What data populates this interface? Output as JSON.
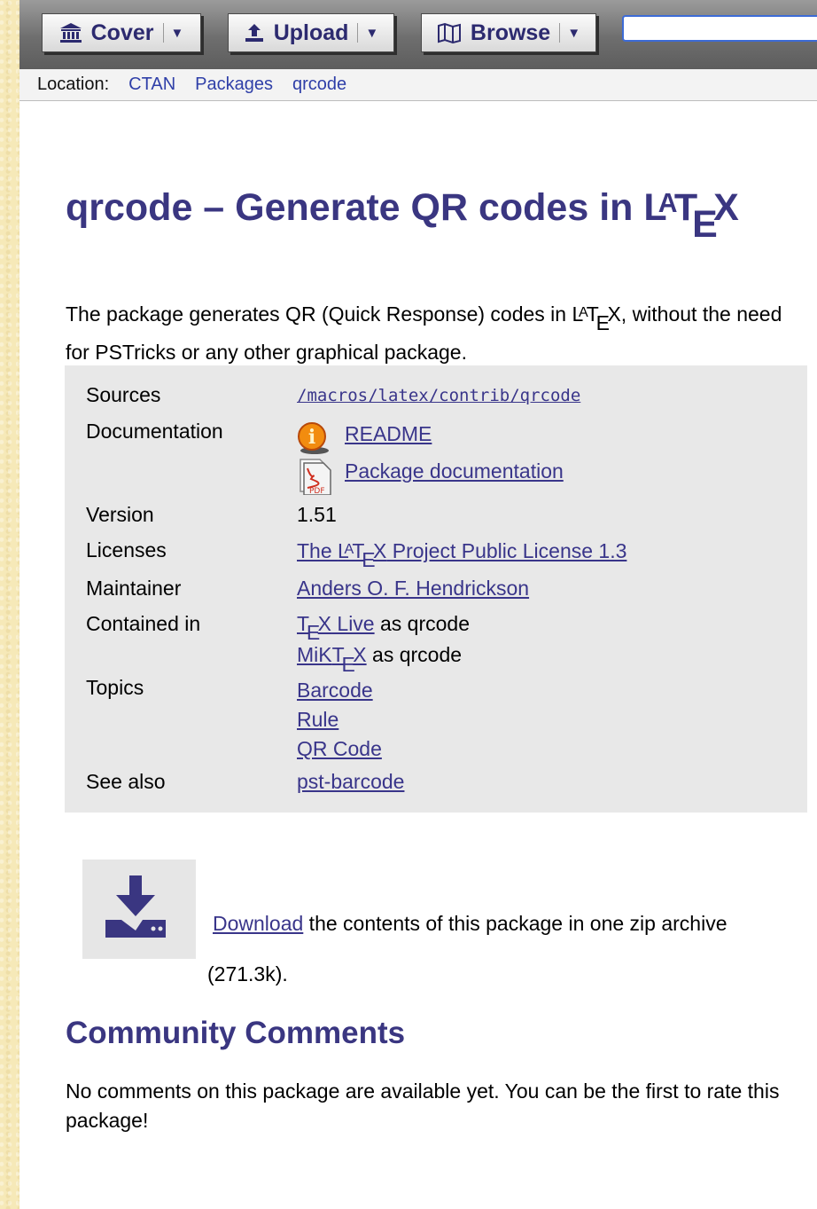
{
  "toolbar": {
    "cover_label": "Cover",
    "upload_label": "Upload",
    "browse_label": "Browse",
    "search_value": ""
  },
  "location": {
    "label": "Location:",
    "crumbs": [
      "CTAN",
      "Packages",
      "qrcode"
    ]
  },
  "title": {
    "prefix": "qrcode – Generate QR codes in ",
    "latex": {
      "L": "L",
      "A": "A",
      "T": "T",
      "E": "E",
      "X": "X"
    }
  },
  "description": {
    "before": "The package generates QR (Quick Response) codes in ",
    "after": ", without the need for PSTricks or any other graphical package."
  },
  "info": {
    "sources_label": "Sources",
    "sources_value": "/macros/latex/contrib/qrcode",
    "documentation_label": "Documentation",
    "docs": [
      "README",
      "Package documentation"
    ],
    "version_label": "Version",
    "version_value": "1.51",
    "licenses_label": "Licenses",
    "license_prefix": "The ",
    "license_suffix": " Project Public License 1.3",
    "maintainer_label": "Maintainer",
    "maintainer_value": "Anders O. F. Hendrickson",
    "contained_label": "Contained in",
    "texlive_suffix": " Live",
    "miktex_prefix": "MiK",
    "as_qrcode": " as qrcode",
    "topics_label": "Topics",
    "topics": [
      "Barcode",
      "Rule",
      "QR Code"
    ],
    "see_also_label": "See also",
    "see_also_value": "pst-barcode"
  },
  "download": {
    "link_text": "Download",
    "text": " the contents of this package in one zip archive",
    "size": "(271.3k)."
  },
  "comments": {
    "heading": "Community Comments",
    "text": "No comments on this package are available yet. You can be the first to rate this package!"
  },
  "colors": {
    "heading": "#3a3681",
    "link": "#39358a",
    "background": "#f6e9b8",
    "info_box": "#e8e8e8"
  }
}
